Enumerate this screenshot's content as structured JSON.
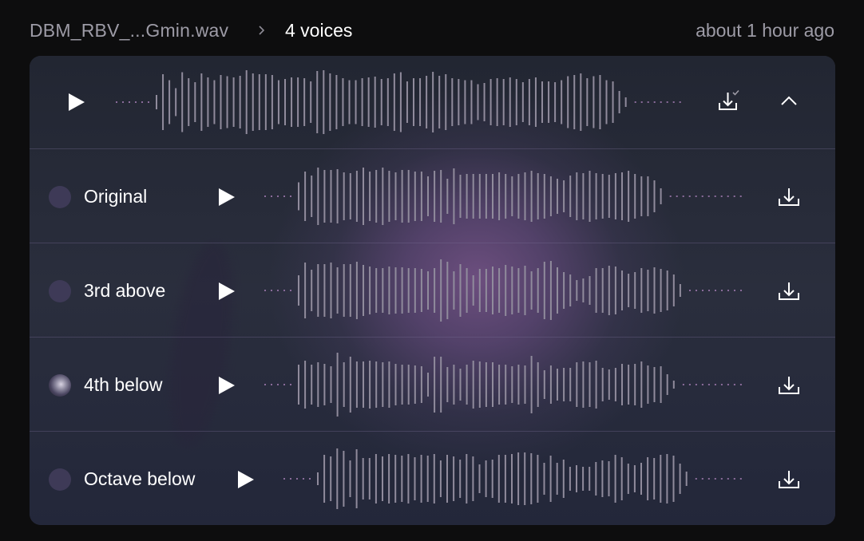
{
  "header": {
    "file_name": "DBM_RBV_...Gmin.wav",
    "separator_icon": "chevron-right-icon",
    "current": "4 voices",
    "timestamp": "about 1 hour ago"
  },
  "main_track": {
    "play_icon": "play-icon",
    "download_icon": "download-done-icon",
    "collapse_icon": "chevron-up-icon",
    "waveform": [
      0.18,
      0.7,
      0.55,
      0.35,
      0.75,
      0.6,
      0.5,
      0.72,
      0.62,
      0.55,
      0.68,
      0.65,
      0.62,
      0.66,
      0.8,
      0.72,
      0.7,
      0.7,
      0.68,
      0.55,
      0.58,
      0.62,
      0.62,
      0.6,
      0.52,
      0.78,
      0.8,
      0.72,
      0.68,
      0.6,
      0.55,
      0.55,
      0.6,
      0.62,
      0.64,
      0.58,
      0.6,
      0.72,
      0.75,
      0.52,
      0.6,
      0.6,
      0.66,
      0.76,
      0.66,
      0.7,
      0.6,
      0.58,
      0.55,
      0.55,
      0.45,
      0.48,
      0.58,
      0.6,
      0.58,
      0.62,
      0.58,
      0.5,
      0.58,
      0.62,
      0.52,
      0.52,
      0.5,
      0.55,
      0.65,
      0.68,
      0.72,
      0.6,
      0.65,
      0.68,
      0.55,
      0.52,
      0.28,
      0.12
    ]
  },
  "voices": [
    {
      "label": "Original",
      "avatar": "empty",
      "play_icon": "play-icon",
      "download_icon": "download-icon",
      "waveform": [
        0.35,
        0.62,
        0.52,
        0.72,
        0.66,
        0.66,
        0.68,
        0.6,
        0.58,
        0.64,
        0.72,
        0.62,
        0.66,
        0.72,
        0.64,
        0.6,
        0.66,
        0.66,
        0.62,
        0.62,
        0.5,
        0.64,
        0.66,
        0.44,
        0.7,
        0.54,
        0.56,
        0.56,
        0.56,
        0.56,
        0.56,
        0.6,
        0.56,
        0.5,
        0.56,
        0.6,
        0.64,
        0.58,
        0.56,
        0.5,
        0.44,
        0.4,
        0.52,
        0.6,
        0.58,
        0.64,
        0.58,
        0.56,
        0.54,
        0.58,
        0.6,
        0.64,
        0.56,
        0.5,
        0.5,
        0.4,
        0.2
      ]
    },
    {
      "label": "3rd above",
      "avatar": "empty",
      "play_icon": "play-icon",
      "download_icon": "download-icon",
      "waveform": [
        0.38,
        0.7,
        0.52,
        0.66,
        0.66,
        0.7,
        0.58,
        0.66,
        0.66,
        0.72,
        0.64,
        0.6,
        0.56,
        0.56,
        0.6,
        0.58,
        0.58,
        0.56,
        0.56,
        0.54,
        0.48,
        0.56,
        0.78,
        0.72,
        0.48,
        0.66,
        0.56,
        0.38,
        0.54,
        0.54,
        0.6,
        0.56,
        0.64,
        0.6,
        0.56,
        0.62,
        0.48,
        0.56,
        0.72,
        0.74,
        0.58,
        0.46,
        0.4,
        0.26,
        0.3,
        0.36,
        0.56,
        0.56,
        0.62,
        0.6,
        0.5,
        0.42,
        0.46,
        0.56,
        0.52,
        0.58,
        0.54,
        0.5,
        0.4,
        0.16
      ]
    },
    {
      "label": "4th below",
      "avatar": "photo",
      "play_icon": "play-icon",
      "download_icon": "download-icon",
      "waveform": [
        0.5,
        0.6,
        0.5,
        0.56,
        0.52,
        0.46,
        0.8,
        0.56,
        0.7,
        0.58,
        0.58,
        0.6,
        0.58,
        0.56,
        0.58,
        0.52,
        0.5,
        0.5,
        0.48,
        0.46,
        0.3,
        0.7,
        0.7,
        0.44,
        0.5,
        0.4,
        0.5,
        0.6,
        0.58,
        0.56,
        0.56,
        0.5,
        0.5,
        0.46,
        0.5,
        0.48,
        0.72,
        0.56,
        0.36,
        0.48,
        0.4,
        0.42,
        0.42,
        0.56,
        0.58,
        0.56,
        0.6,
        0.42,
        0.38,
        0.42,
        0.52,
        0.5,
        0.52,
        0.58,
        0.48,
        0.44,
        0.46,
        0.26,
        0.1
      ]
    },
    {
      "label": "Octave below",
      "avatar": "empty",
      "play_icon": "play-icon",
      "download_icon": "download-icon",
      "waveform": [
        0.16,
        0.6,
        0.56,
        0.76,
        0.7,
        0.46,
        0.74,
        0.52,
        0.52,
        0.62,
        0.56,
        0.62,
        0.6,
        0.58,
        0.62,
        0.54,
        0.6,
        0.58,
        0.62,
        0.46,
        0.6,
        0.56,
        0.48,
        0.62,
        0.56,
        0.36,
        0.46,
        0.48,
        0.6,
        0.6,
        0.62,
        0.66,
        0.66,
        0.64,
        0.6,
        0.4,
        0.58,
        0.4,
        0.48,
        0.3,
        0.34,
        0.3,
        0.3,
        0.42,
        0.46,
        0.44,
        0.6,
        0.54,
        0.38,
        0.34,
        0.4,
        0.54,
        0.52,
        0.6,
        0.62,
        0.58,
        0.38,
        0.18
      ]
    }
  ],
  "colors": {
    "bar": "#908b9c",
    "dot": "#8a6c9a",
    "icon": "#ffffff",
    "check": "#9d9ba6"
  }
}
